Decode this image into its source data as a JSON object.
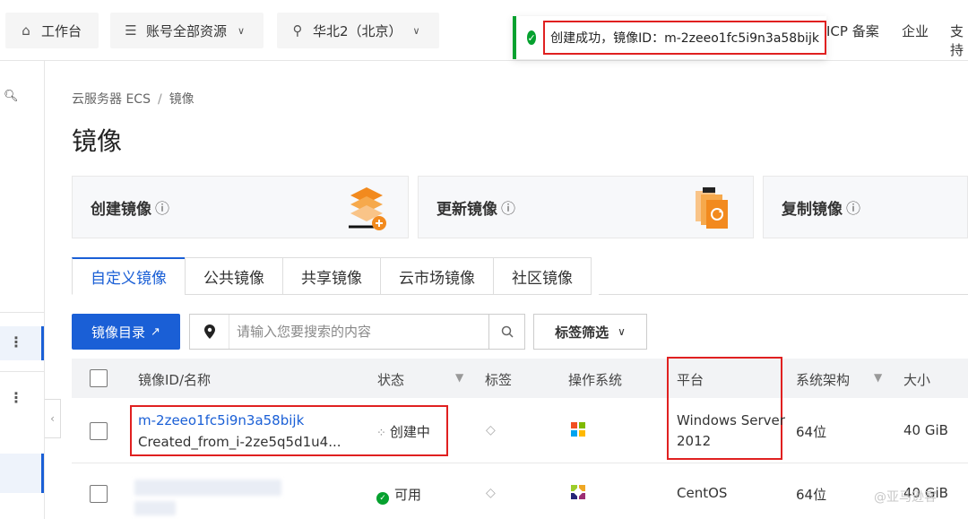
{
  "topbar": {
    "workbench": "工作台",
    "resources": "账号全部资源",
    "region": "华北2（北京）",
    "icp": "ICP 备案",
    "enterprise": "企业",
    "support": "支持"
  },
  "toast": {
    "message": "创建成功，镜像ID：m-2zeeo1fc5i9n3a58bijk",
    "status_color": "#06a12f"
  },
  "breadcrumb": {
    "parent": "云服务器 ECS",
    "separator": "/",
    "current": "镜像"
  },
  "page_title": "镜像",
  "cards": [
    {
      "label": "创建镜像"
    },
    {
      "label": "更新镜像"
    },
    {
      "label": "复制镜像"
    }
  ],
  "tabs": [
    {
      "label": "自定义镜像",
      "active": true
    },
    {
      "label": "公共镜像"
    },
    {
      "label": "共享镜像"
    },
    {
      "label": "云市场镜像"
    },
    {
      "label": "社区镜像"
    }
  ],
  "toolbar": {
    "catalog_button": "镜像目录",
    "search_placeholder": "请输入您要搜索的内容",
    "tag_filter": "标签筛选"
  },
  "table": {
    "headers": {
      "id_name": "镜像ID/名称",
      "status": "状态",
      "tags": "标签",
      "os": "操作系统",
      "platform": "平台",
      "arch": "系统架构",
      "size": "大小"
    },
    "rows": [
      {
        "id": "m-2zeeo1fc5i9n3a58bijk",
        "name": "Created_from_i-2ze5q5d1u4...",
        "status": "创建中",
        "os_icon": "windows-icon",
        "platform_line1": "Windows Server",
        "platform_line2": "2012",
        "arch": "64位",
        "size": "40 GiB"
      },
      {
        "id": "",
        "name": "",
        "status": "可用",
        "os_icon": "centos-icon",
        "platform_line1": "CentOS",
        "platform_line2": "",
        "arch": "64位",
        "size": "40 GiB"
      }
    ]
  },
  "watermark": "@亚马逊客",
  "accent_color": "#1a5fd6",
  "highlight_color": "#e02020"
}
